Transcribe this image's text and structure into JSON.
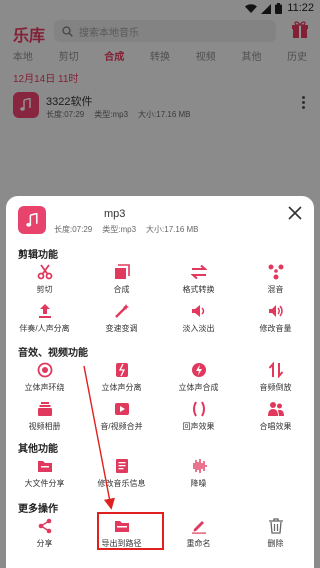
{
  "status": {
    "time": "11:22"
  },
  "header": {
    "title": "乐库",
    "search_placeholder": "搜索本地音乐"
  },
  "tabs": [
    {
      "label": "本地"
    },
    {
      "label": "剪切"
    },
    {
      "label": "合成"
    },
    {
      "label": "转换"
    },
    {
      "label": "视频"
    },
    {
      "label": "其他"
    },
    {
      "label": "历史"
    }
  ],
  "active_tab": "合成",
  "date": "12月14日  11时",
  "file": {
    "name": "3322软件",
    "duration": "长度:07:29",
    "type": "类型:mp3",
    "size": "大小:17.16 MB"
  },
  "sheet": {
    "title": "mp3",
    "duration": "长度:07:29",
    "type": "类型:mp3",
    "size": "大小:17.16 MB",
    "sections": [
      {
        "title": "剪辑功能",
        "items": [
          {
            "label": "剪切",
            "icon": "scissors-icon"
          },
          {
            "label": "合成",
            "icon": "merge-icon"
          },
          {
            "label": "格式转换",
            "icon": "convert-icon"
          },
          {
            "label": "混音",
            "icon": "mix-icon"
          },
          {
            "label": "伴奏/人声分离",
            "icon": "upload-icon"
          },
          {
            "label": "变速变调",
            "icon": "magic-wand-icon"
          },
          {
            "label": "淡入淡出",
            "icon": "fade-icon"
          },
          {
            "label": "修改音量",
            "icon": "volume-icon"
          }
        ]
      },
      {
        "title": "音效、视频功能",
        "items": [
          {
            "label": "立体声环绕",
            "icon": "surround-icon"
          },
          {
            "label": "立体声分离",
            "icon": "split-icon"
          },
          {
            "label": "立体声合成",
            "icon": "bolt-icon"
          },
          {
            "label": "音频倒放",
            "icon": "reverse-icon"
          },
          {
            "label": "视频相册",
            "icon": "album-icon"
          },
          {
            "label": "音/视频合并",
            "icon": "av-merge-icon"
          },
          {
            "label": "回声效果",
            "icon": "echo-icon"
          },
          {
            "label": "合唱效果",
            "icon": "chorus-icon"
          }
        ]
      },
      {
        "title": "其他功能",
        "items": [
          {
            "label": "大文件分享",
            "icon": "folder-share-icon"
          },
          {
            "label": "修改音乐信息",
            "icon": "edit-info-icon"
          },
          {
            "label": "降噪",
            "icon": "waveform-icon"
          }
        ]
      },
      {
        "title": "更多操作",
        "items": [
          {
            "label": "分享",
            "icon": "share-icon"
          },
          {
            "label": "导出到路径",
            "icon": "export-folder-icon"
          },
          {
            "label": "重命名",
            "icon": "rename-icon"
          },
          {
            "label": "删除",
            "icon": "trash-icon"
          }
        ]
      }
    ]
  },
  "colors": {
    "accent": "#e0395d",
    "highlight": "#e0201f",
    "background": "#f1eff1"
  }
}
